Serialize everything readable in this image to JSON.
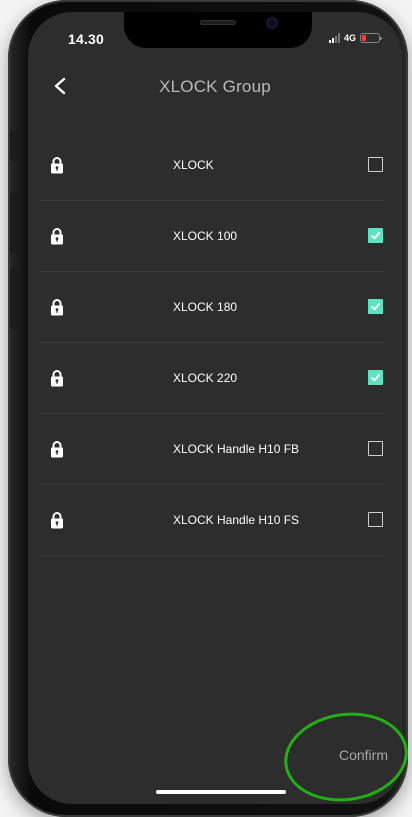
{
  "status_bar": {
    "time": "14.30",
    "network": "4G"
  },
  "header": {
    "title": "XLOCK Group",
    "back_icon": "chevron-left-icon"
  },
  "colors": {
    "screen_bg": "#2d2d2d",
    "checkbox_checked": "#5fe2c3",
    "highlight": "#22b014",
    "battery_low": "#ff3b30"
  },
  "locks": [
    {
      "label": "XLOCK",
      "checked": false,
      "icon": "lock-icon"
    },
    {
      "label": "XLOCK 100",
      "checked": true,
      "icon": "lock-icon"
    },
    {
      "label": "XLOCK 180",
      "checked": true,
      "icon": "lock-icon"
    },
    {
      "label": "XLOCK 220",
      "checked": true,
      "icon": "lock-icon"
    },
    {
      "label": "XLOCK Handle H10 FB",
      "checked": false,
      "icon": "lock-icon"
    },
    {
      "label": "XLOCK Handle H10 FS",
      "checked": false,
      "icon": "lock-icon"
    }
  ],
  "footer": {
    "confirm_label": "Confirm"
  }
}
